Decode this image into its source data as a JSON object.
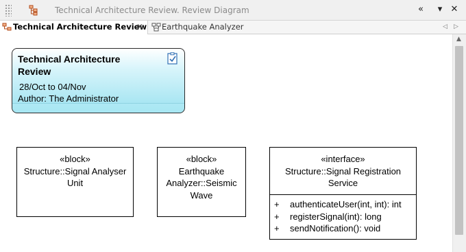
{
  "window": {
    "title": "Technical Architecture Review.  Review Diagram",
    "controls": {
      "overflow": "«",
      "dropdown": "▾",
      "close": "✕"
    }
  },
  "tabs": [
    {
      "label": "Technical Architecture Review",
      "close": "✕"
    },
    {
      "label": "Earthquake Analyzer"
    }
  ],
  "tab_nav": {
    "prev": "◁",
    "next": "▷"
  },
  "scrollbar": {
    "up": "▲"
  },
  "note": {
    "title": "Technical Architecture Review",
    "dates": "28/Oct to 04/Nov",
    "author": "Author: The Administrator",
    "icon": "review-checklist-icon"
  },
  "elements": [
    {
      "stereotype": "«block»",
      "name": "Structure::Signal Analyser Unit"
    },
    {
      "stereotype": "«block»",
      "name": "Earthquake Analyzer::Seismic Wave"
    },
    {
      "stereotype": "«interface»",
      "name": "Structure::Signal Registration Service",
      "operations": [
        {
          "visibility": "+",
          "signature": "authenticateUser(int, int): int"
        },
        {
          "visibility": "+",
          "signature": "registerSignal(int): long"
        },
        {
          "visibility": "+",
          "signature": "sendNotification(): void"
        }
      ]
    }
  ],
  "colors": {
    "note_fill": "#9ce2f0",
    "active_tab": "#ffffff",
    "chrome": "#f0f0f0"
  }
}
